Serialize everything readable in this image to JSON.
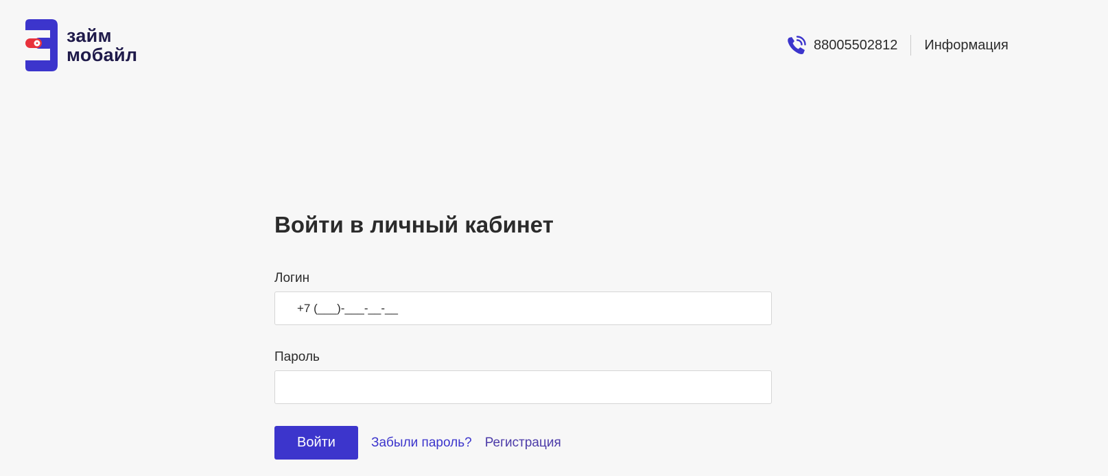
{
  "brand": {
    "name_line1": "займ",
    "name_line2": "мобайл",
    "primary_color": "#3c35cc",
    "accent_color": "#e8323c"
  },
  "header": {
    "phone_icon": "phone-icon",
    "phone": "88005502812",
    "info_link": "Информация"
  },
  "form": {
    "title": "Войти в личный кабинет",
    "login_label": "Логин",
    "login_placeholder": "+7 (___)-___-__-__",
    "password_label": "Пароль",
    "password_value": "",
    "submit_label": "Войти",
    "forgot_link": "Забыли пароль?",
    "register_link": "Регистрация"
  }
}
